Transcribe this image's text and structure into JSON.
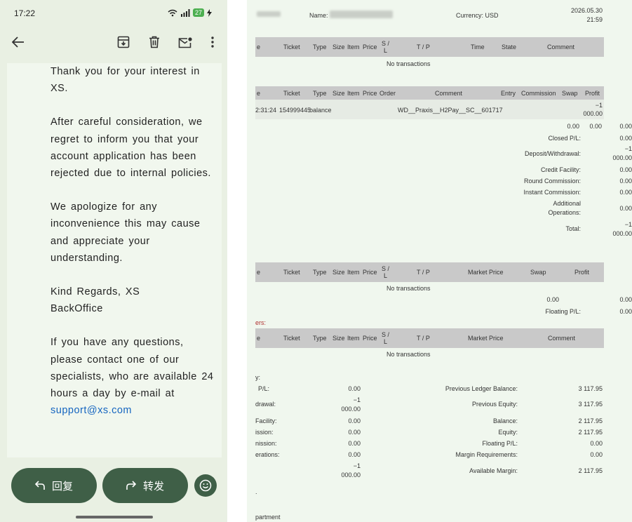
{
  "phone": {
    "status": {
      "time": "17:22",
      "battery": "27"
    },
    "email": {
      "paragraphs": [
        "Thank you for your interest in XS.",
        "After careful consideration, we regret to inform you that your account application has been rejected due to internal policies.",
        "We apologize for any inconvenience this may cause and appreciate your understanding.",
        "Kind Regards, XS BackOffice",
        "If you have any questions, please contact one of our specialists, who are available 24 hours a day by e-mail at"
      ],
      "link": "support@xs.com"
    },
    "actions": {
      "reply": "回复",
      "forward": "转发"
    }
  },
  "statement": {
    "header": {
      "name_label": "Name:",
      "currency": "Currency: USD",
      "date": "2026.05.30",
      "time": "21:59"
    },
    "open_positions_header": [
      "e",
      "Ticket",
      "Type",
      "Size",
      "Item",
      "Price",
      "S /",
      "L",
      "T / P",
      "Time",
      "State",
      "Comment"
    ],
    "no_transactions": "No transactions",
    "closed_header": [
      "e",
      "Ticket",
      "Type",
      "Size",
      "Item",
      "Price",
      "Order",
      "Comment",
      "Entry",
      "Commission",
      "Swap",
      "Profit"
    ],
    "balance_row": {
      "time": "2:31:24",
      "ticket": "154999445",
      "type": "balance",
      "comment": "WD__Praxis__H2Pay__SC__601717",
      "profit_1": "−1",
      "profit_2": "000.00"
    },
    "closed_summary": {
      "totals": [
        "0.00",
        "0.00",
        "0.00"
      ],
      "closed_pl": {
        "label": "Closed P/L:",
        "value": "0.00"
      },
      "deposit": {
        "label": "Deposit/Withdrawal:",
        "value_1": "−1",
        "value_2": "000.00"
      },
      "credit": {
        "label": "Credit Facility:",
        "value": "0.00"
      },
      "round": {
        "label": "Round Commission:",
        "value": "0.00"
      },
      "instant": {
        "label": "Instant Commission:",
        "value": "0.00"
      },
      "additional": {
        "label_1": "Additional",
        "label_2": "Operations:",
        "value": "0.00"
      },
      "total": {
        "label": "Total:",
        "value_1": "−1",
        "value_2": "000.00"
      }
    },
    "open_trades_header": [
      "e",
      "Ticket",
      "Type",
      "Size",
      "Item",
      "Price",
      "S /",
      "L",
      "T / P",
      "Market Price",
      "Swap",
      "Profit"
    ],
    "floating": {
      "v1": "0.00",
      "v2": "0.00",
      "label": "Floating P/L:",
      "value": "0.00"
    },
    "orders_label": "ers:",
    "orders_header": [
      "e",
      "Ticket",
      "Type",
      "Size",
      "Item",
      "Price",
      "S /",
      "L",
      "T / P",
      "Market Price",
      "Comment"
    ],
    "summary_label": "y:",
    "left_summary": [
      {
        "label": "P/L:",
        "value": "0.00"
      },
      {
        "label": "drawal:",
        "value_1": "−1",
        "value_2": "000.00"
      },
      {
        "label": "Facility:",
        "value": "0.00"
      },
      {
        "label": "ission:",
        "value": "0.00"
      },
      {
        "label": "nission:",
        "value": "0.00"
      },
      {
        "label": "erations:",
        "value": "0.00"
      },
      {
        "value_1": "−1",
        "value_2": "000.00"
      }
    ],
    "right_summary": [
      {
        "label": "Previous Ledger Balance:",
        "value": "3 117.95"
      },
      {
        "label": "Previous Equity:",
        "value": "3 117.95"
      },
      {
        "label": "Balance:",
        "value": "2 117.95"
      },
      {
        "label": "Equity:",
        "value": "2 117.95"
      },
      {
        "label": "Floating P/L:",
        "value": "0.00"
      },
      {
        "label": "Margin Requirements:",
        "value": "0.00"
      },
      {
        "label": "Available Margin:",
        "value": "2 117.95"
      }
    ],
    "dot": ".",
    "footer": "partment"
  }
}
